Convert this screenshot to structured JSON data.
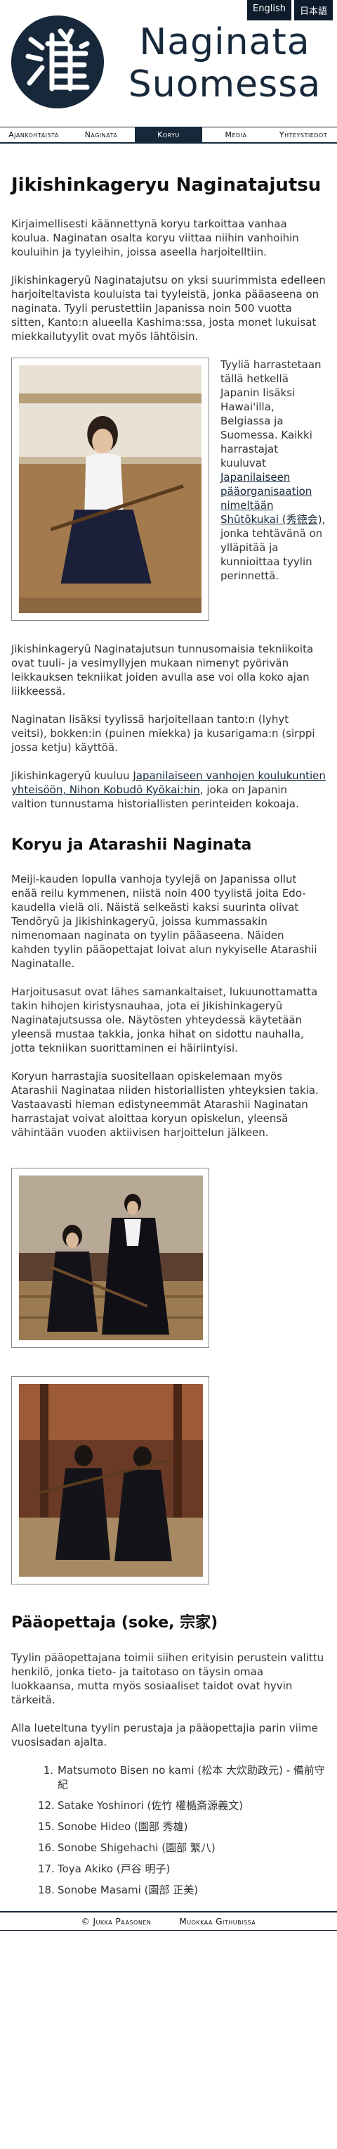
{
  "lang": {
    "en": "English",
    "ja": "日本語"
  },
  "site": {
    "title_line1": "Naginata",
    "title_line2": "Suomessa",
    "logo_icon": "naginata-kanji-logo"
  },
  "nav": [
    {
      "label": "Ajankohtaista"
    },
    {
      "label": "Naginata"
    },
    {
      "label": "Koryu",
      "active": true
    },
    {
      "label": "Media"
    },
    {
      "label": "Yhteystiedot"
    }
  ],
  "page": {
    "title": "Jikishinkageryu Naginatajutsu",
    "p1": "Kirjaimellisesti käännettynä koryu tarkoittaa vanhaa koulua. Naginatan osalta koryu viittaa niihin vanhoihin kouluihin ja tyyleihin, joissa aseella harjoitelltiin.",
    "p2": "Jikishinkageryū Naginatajutsu on yksi suurimmista edelleen harjoiteltavista kouluista tai tyyleistä, jonka pääaseena on naginata. Tyyli perustettiin Japanissa noin 500 vuotta sitten, Kanto:n alueella Kashima:ssa, josta monet lukuisat miekkailutyylit ovat myös lähtöisin.",
    "float_text_a": "Tyyliä harrastetaan tällä hetkellä Japanin lisäksi Hawai'illa, Belgiassa ja Suomessa. Kaikki harrastajat kuuluvat ",
    "float_link": "Japanilaiseen pääorganisaation nimeltään Shūtōkukai (秀徳会)",
    "float_text_b": ", jonka tehtävänä on ylläpitää ja kunnioittaa tyylin perinnettä.",
    "p3": "Jikishinkageryū Naginatajutsun tunnusomaisia tekniikoita ovat tuuli- ja vesimyllyjen mukaan nimenyt pyörivän leikkauksen tekniikat joiden avulla ase voi olla koko ajan liikkeessä.",
    "p4": "Naginatan lisäksi tyylissä harjoitellaan tanto:n (lyhyt veitsi), bokken:in (puinen miekka) ja kusarigama:n (sirppi jossa ketju) käyttöä.",
    "p5_a": "Jikishinkageryū kuuluu ",
    "p5_link": "Japanilaiseen vanhojen koulukuntien yhteisöön, Nihon Kobudō Kyōkai:hin",
    "p5_b": ", joka on Japanin valtion tunnustama historiallisten perinteiden kokoaja."
  },
  "section2": {
    "title": "Koryu ja Atarashii Naginata",
    "p1": "Meiji-kauden lopulla vanhoja tyylejä on Japanissa ollut enää reilu kymmenen, niistä noin 400 tyylistä joita Edo-kaudella vielä oli. Näistä selkeästi kaksi suurinta olivat Tendōryū ja Jikishinkageryū, joissa kummassakin nimenomaan naginata on tyylin pääaseena. Näiden kahden tyylin pääopettajat loivat alun nykyiselle Atarashii Naginatalle.",
    "p2": "Harjoitusasut ovat lähes samankaltaiset, lukuunottamatta takin hihojen kiristysnauhaa, jota ei Jikishinkageryū Naginatajutsussa ole. Näytösten yhteydessä käytetään yleensä mustaa takkia, jonka hihat on sidottu nauhalla, jotta tekniikan suorittaminen ei häiriintyisi.",
    "p3": "Koryun harrastajia suositellaan opiskelemaan myös Atarashii Naginataa niiden historiallisten yhteyksien takia. Vastaavasti hieman edistyneemmät Atarashii Naginatan harrastajat voivat aloittaa koryun opiskelun, yleensä vähintään vuoden aktiivisen harjoittelun jälkeen."
  },
  "section3": {
    "title": "Pääopettaja (soke, 宗家)",
    "p1": "Tyylin pääopettajana toimii siihen erityisin perustein valittu henkilö, jonka tieto- ja taitotaso on täysin omaa luokkaansa, mutta myös sosiaaliset taidot ovat hyvin tärkeitä.",
    "p2": "Alla lueteltuna tyylin perustaja ja pääopettajia parin viime vuosisadan ajalta.",
    "list": [
      {
        "num": "1.",
        "text": "Matsumoto Bisen no kami (松本 大炊助政元) - 備前守紀"
      },
      {
        "num": "12.",
        "text": "Satake Yoshinori (佐竹 權楯斎源義文)"
      },
      {
        "num": "15.",
        "text": "Sonobe Hideo (園部 秀雄)"
      },
      {
        "num": "16.",
        "text": "Sonobe Shigehachi (園部 繁八)"
      },
      {
        "num": "17.",
        "text": "Toya Akiko (戸谷 明子)"
      },
      {
        "num": "18.",
        "text": "Sonobe Masami (園部 正美)"
      }
    ]
  },
  "footer": {
    "left": "© Jukka Paasonen",
    "right": "Muokkaa Githubissa"
  }
}
